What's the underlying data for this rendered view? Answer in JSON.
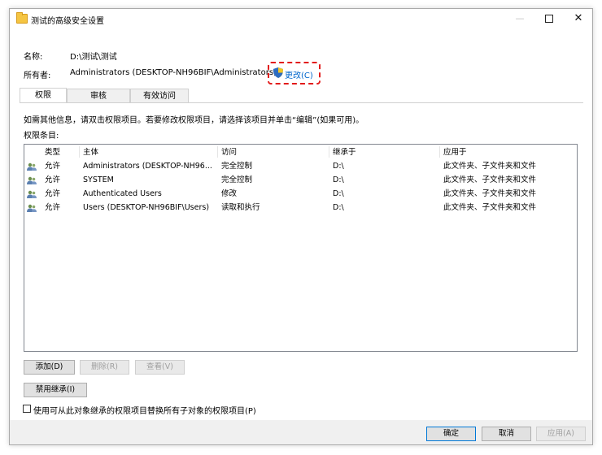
{
  "window": {
    "title": "测试的高级安全设置",
    "close_glyph": "✕",
    "min_glyph": "—"
  },
  "info": {
    "name_label": "名称:",
    "name_value": "D:\\测试\\测试",
    "owner_label": "所有者:",
    "owner_value": "Administrators (DESKTOP-NH96BIF\\Administrators)",
    "change_link": "更改(C)"
  },
  "tabs": [
    {
      "label": "权限",
      "active": true
    },
    {
      "label": "审核",
      "active": false
    },
    {
      "label": "有效访问",
      "active": false
    }
  ],
  "hint_text": "如需其他信息，请双击权限项目。若要修改权限项目，请选择该项目并单击“编辑”(如果可用)。",
  "entries_label": "权限条目:",
  "columns": [
    "类型",
    "主体",
    "访问",
    "继承于",
    "应用于"
  ],
  "rows": [
    {
      "type": "允许",
      "principal": "Administrators (DESKTOP-NH96...",
      "access": "完全控制",
      "inherited": "D:\\",
      "applies": "此文件夹、子文件夹和文件"
    },
    {
      "type": "允许",
      "principal": "SYSTEM",
      "access": "完全控制",
      "inherited": "D:\\",
      "applies": "此文件夹、子文件夹和文件"
    },
    {
      "type": "允许",
      "principal": "Authenticated Users",
      "access": "修改",
      "inherited": "D:\\",
      "applies": "此文件夹、子文件夹和文件"
    },
    {
      "type": "允许",
      "principal": "Users (DESKTOP-NH96BIF\\Users)",
      "access": "读取和执行",
      "inherited": "D:\\",
      "applies": "此文件夹、子文件夹和文件"
    }
  ],
  "buttons": {
    "add": "添加(D)",
    "remove": "删除(R)",
    "view": "查看(V)",
    "disable_inheritance": "禁用继承(I)",
    "ok": "确定",
    "cancel": "取消",
    "apply": "应用(A)"
  },
  "replace_checkbox_label": "使用可从此对象继承的权限项目替换所有子对象的权限项目(P)",
  "colors": {
    "link": "#0066cc",
    "highlight": "#e21a1a",
    "accent": "#0078d7"
  }
}
